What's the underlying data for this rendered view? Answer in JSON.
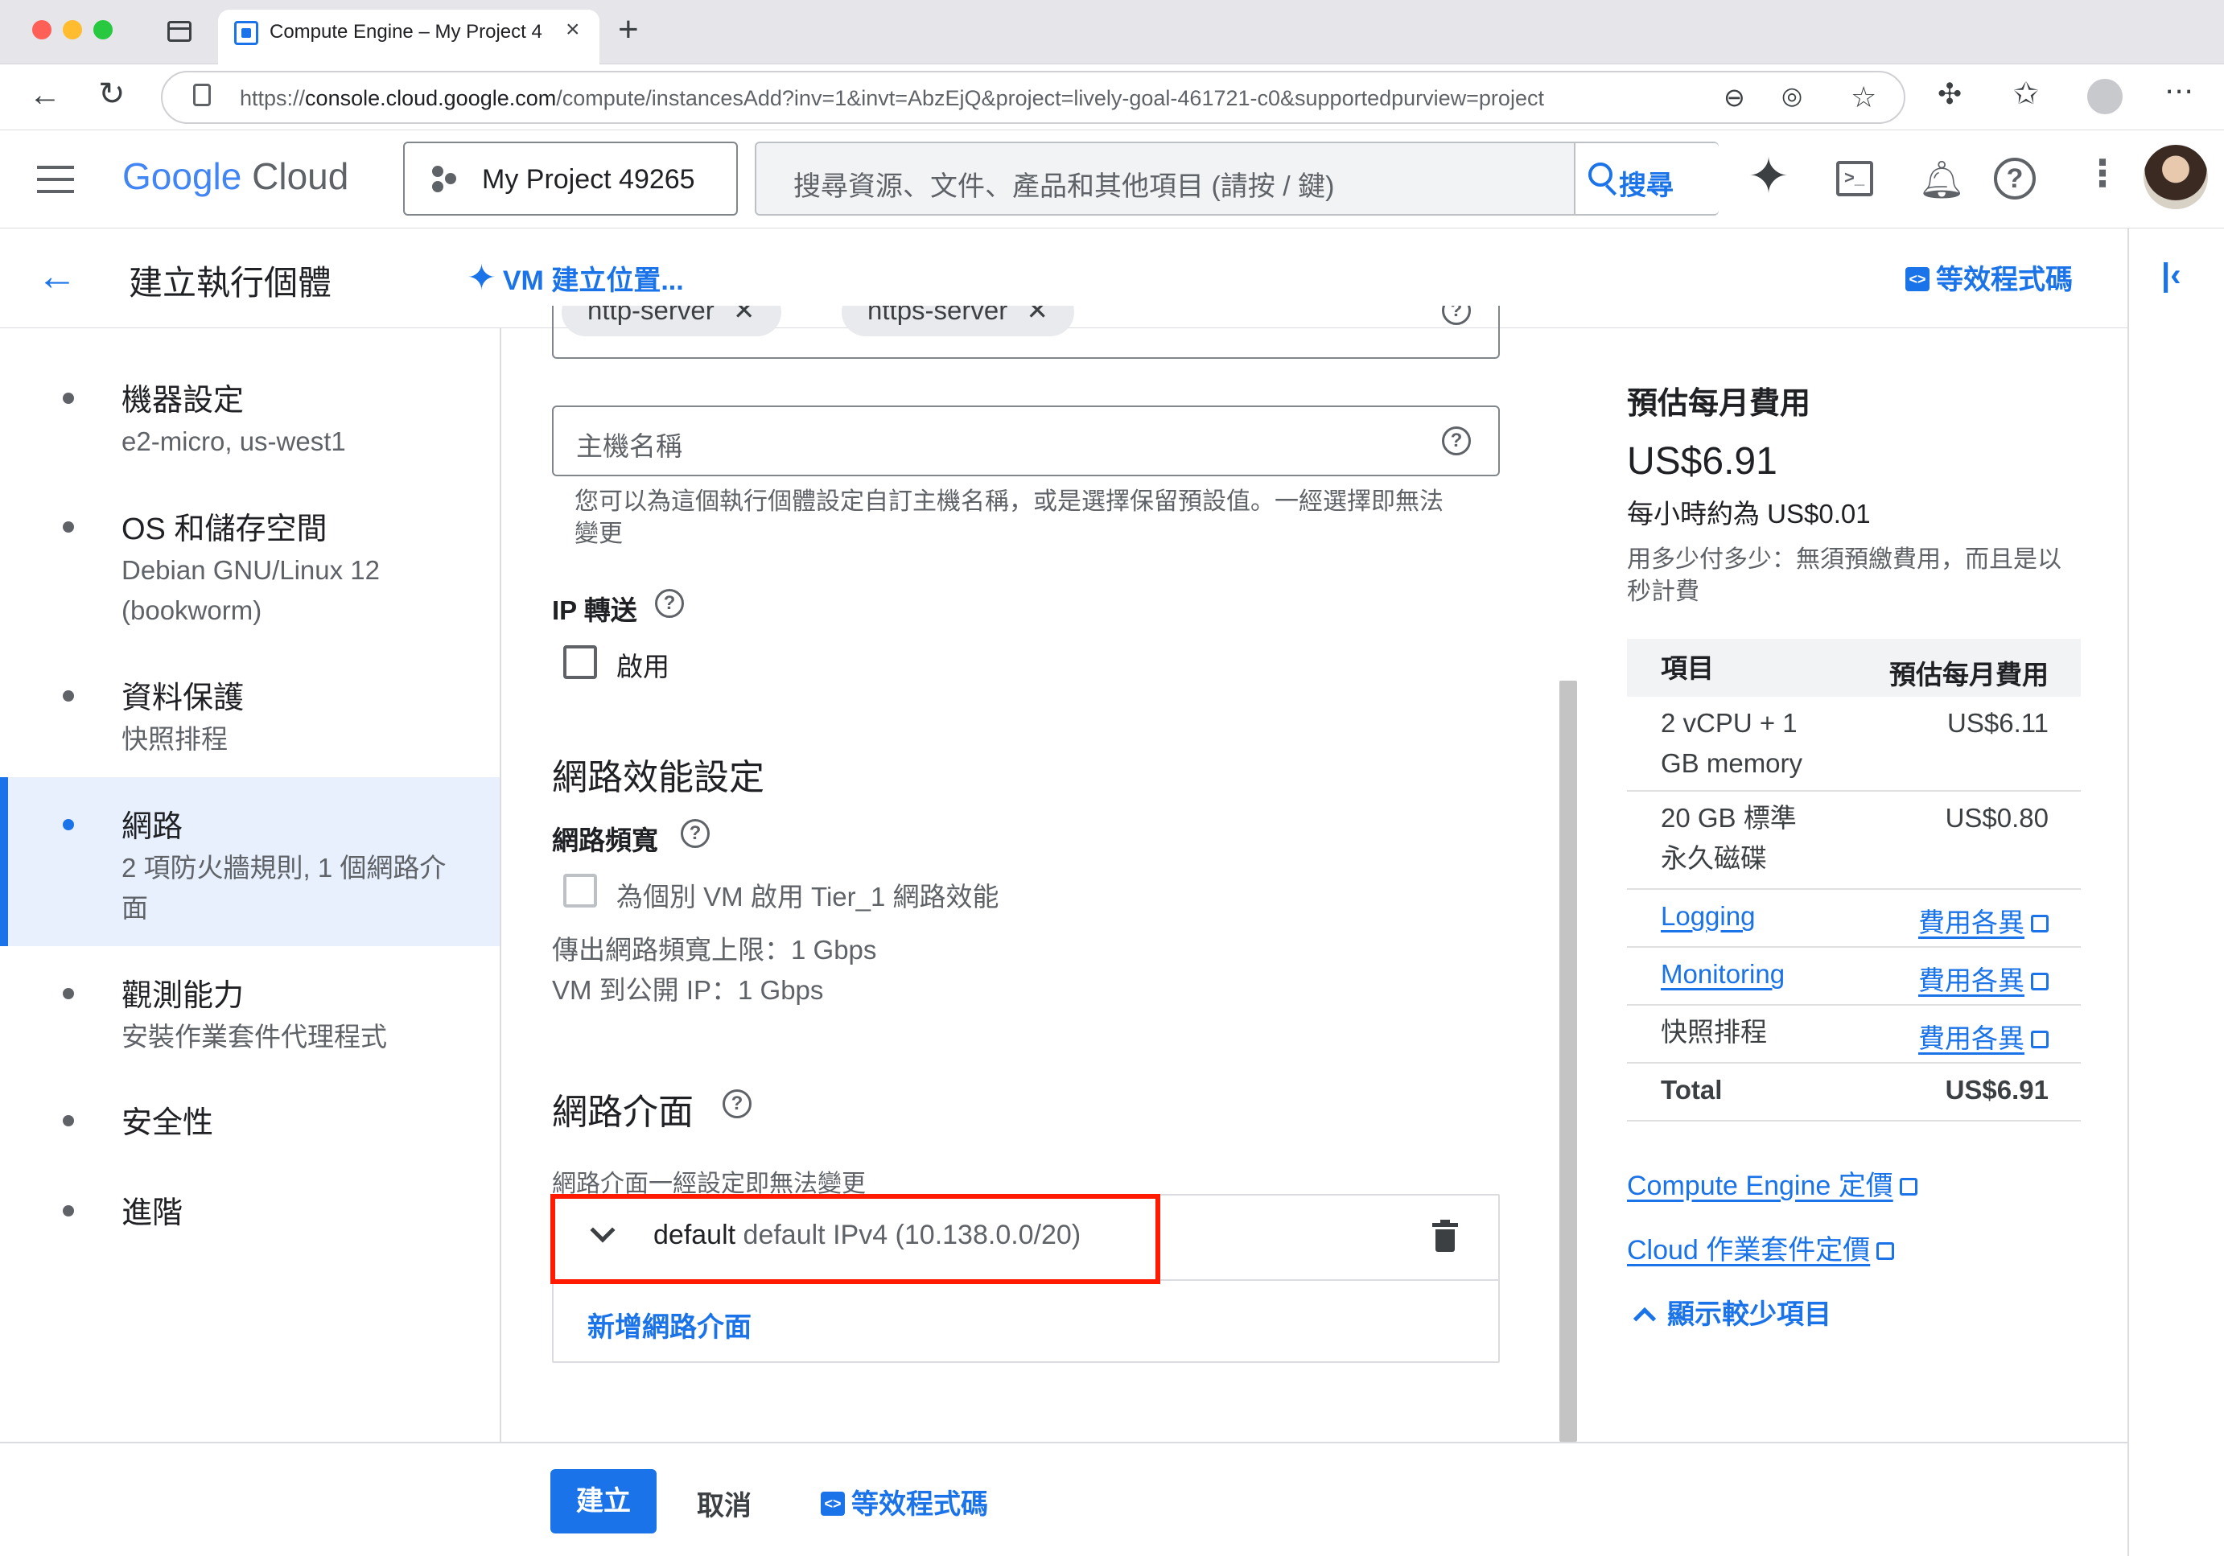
{
  "browser": {
    "tab_title": "Compute Engine – My Project 4",
    "url_prefix": "https://",
    "url_host": "console.cloud.google.com",
    "url_path": "/compute/instancesAdd?inv=1&invt=AbzEjQ&project=lively-goal-461721-c0&supportedpurview=project"
  },
  "header": {
    "logo_google": "Google",
    "logo_cloud": "Cloud",
    "project_name": "My Project 49265",
    "search_placeholder": "搜尋資源、文件、產品和其他項目 (請按 / 鍵)",
    "search_button": "搜尋"
  },
  "titlebar": {
    "title": "建立執行個體",
    "vm_helper": "VM 建立位置...",
    "equivalent_code": "等效程式碼"
  },
  "nav": [
    {
      "title": "機器設定",
      "sub": "e2-micro, us-west1"
    },
    {
      "title": "OS 和儲存空間",
      "sub": "Debian GNU/Linux 12 (bookworm)"
    },
    {
      "title": "資料保護",
      "sub": "快照排程"
    },
    {
      "title": "網路",
      "sub": "2 項防火牆規則, 1 個網路介面"
    },
    {
      "title": "觀測能力",
      "sub": "安裝作業套件代理程式"
    },
    {
      "title": "安全性",
      "sub": ""
    },
    {
      "title": "進階",
      "sub": ""
    }
  ],
  "form": {
    "tags": [
      "http-server",
      "https-server"
    ],
    "hostname_placeholder": "主機名稱",
    "hostname_hint_1": "您可以為這個執行個體設定自訂主機名稱，或是選擇保留預設值。一經選擇即無法",
    "hostname_hint_2": "變更",
    "ip_forwarding_label": "IP 轉送",
    "ip_forwarding_enable": "啟用",
    "perf_heading": "網路效能設定",
    "bandwidth_label": "網路頻寬",
    "tier1_label": "為個別 VM 啟用 Tier_1 網路效能",
    "egress_limit": "傳出網路頻寬上限：1 Gbps",
    "public_ip_bw": "VM 到公開 IP：1 Gbps",
    "nic_heading": "網路介面",
    "nic_note": "網路介面一經設定即無法變更",
    "nic_name": "default",
    "nic_detail": "default IPv4 (10.138.0.0/20)",
    "add_nic": "新增網路介面"
  },
  "cost": {
    "heading": "預估每月費用",
    "monthly": "US$6.91",
    "hourly": "每小時約為 US$0.01",
    "note_1": "用多少付多少：無須預繳費用，而且是以",
    "note_2": "秒計費",
    "col_item": "項目",
    "col_cost": "預估每月費用",
    "rows": [
      {
        "item": "2 vCPU + 1 GB memory",
        "cost": "US$6.11"
      },
      {
        "item": "20 GB 標準永久磁碟",
        "cost": "US$0.80"
      },
      {
        "item": "Logging",
        "cost": "費用各異"
      },
      {
        "item": "Monitoring",
        "cost": "費用各異"
      },
      {
        "item": "快照排程",
        "cost": "費用各異"
      },
      {
        "item": "Total",
        "cost": "US$6.91"
      }
    ],
    "link_ce_pricing": "Compute Engine 定價",
    "link_ops_pricing": "Cloud 作業套件定價",
    "show_less": "顯示較少項目"
  },
  "footer": {
    "create": "建立",
    "cancel": "取消",
    "equivalent_code": "等效程式碼"
  },
  "colors": {
    "accent": "#1a73e8",
    "highlight_box": "#ff1a00",
    "nav_active_bg": "#e8f0fe"
  }
}
